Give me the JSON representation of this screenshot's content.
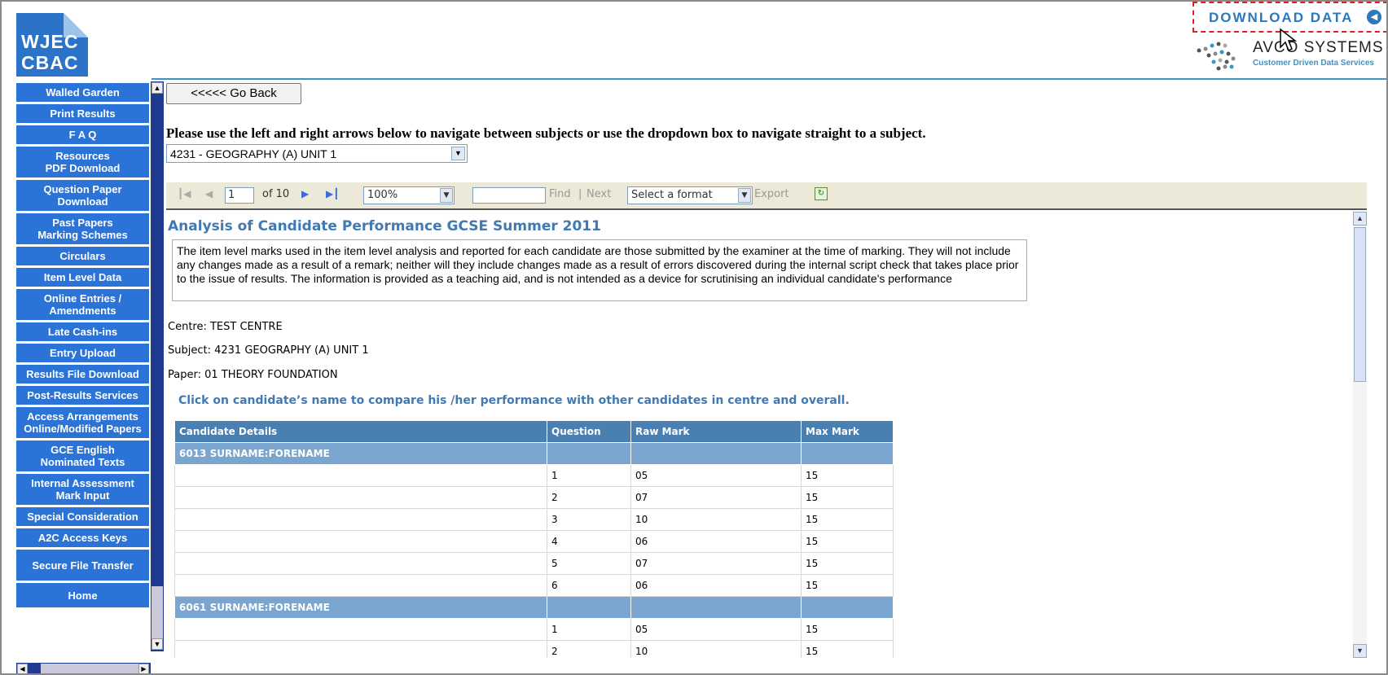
{
  "logo": {
    "line1": "WJEC",
    "line2": "CBAC"
  },
  "download": {
    "label": "DOWNLOAD DATA"
  },
  "avco": {
    "name": "AVCO SYSTEMS",
    "tagline": "Customer Driven Data Services"
  },
  "sidebar": {
    "items": [
      {
        "label": "Walled Garden"
      },
      {
        "label": "Print Results"
      },
      {
        "label": "F A Q"
      },
      {
        "label": "Resources\nPDF Download"
      },
      {
        "label": "Question Paper\nDownload"
      },
      {
        "label": "Past Papers\nMarking Schemes"
      },
      {
        "label": "Circulars"
      },
      {
        "label": "Item Level Data"
      },
      {
        "label": "Online Entries /\nAmendments"
      },
      {
        "label": "Late Cash-ins"
      },
      {
        "label": "Entry Upload"
      },
      {
        "label": "Results File Download"
      },
      {
        "label": "Post-Results Services"
      },
      {
        "label": "Access Arrangements\nOnline/Modified Papers"
      },
      {
        "label": "GCE English\nNominated Texts"
      },
      {
        "label": "Internal Assessment\nMark Input"
      },
      {
        "label": "Special Consideration"
      },
      {
        "label": "A2C Access Keys"
      },
      {
        "label": "Secure File Transfer"
      },
      {
        "label": "Home"
      }
    ]
  },
  "main": {
    "go_back": "<<<<< Go Back",
    "instructions": "Please use the left and right arrows below to navigate between subjects or use the dropdown box to navigate straight to a subject.",
    "subject_selected": "4231 - GEOGRAPHY (A) UNIT 1"
  },
  "toolbar": {
    "page": "1",
    "of_pages": "of 10",
    "zoom": "100%",
    "find_value": "",
    "find_label": "Find",
    "separator": "|",
    "next_label": "Next",
    "format_placeholder": "Select a format",
    "export_label": "Export"
  },
  "report": {
    "title": "Analysis of Candidate Performance GCSE Summer 2011",
    "disclaimer": "The item level marks used in the item level analysis and reported for each candidate are those submitted by the examiner at the time of marking. They will not include any changes made as a result of a remark; neither will they include changes made as a result of errors discovered during the internal script check that takes place prior to the issue of results. The information is provided as a teaching aid, and is not intended as a device for scrutinising an individual candidate's performance",
    "centre": "Centre: TEST CENTRE",
    "subject": "Subject: 4231 GEOGRAPHY (A) UNIT 1",
    "paper": "Paper: 01 THEORY FOUNDATION",
    "compare_hint": "Click on candidate’s name to compare his /her performance with other candidates in centre and overall.",
    "table": {
      "headers": [
        "Candidate Details",
        "Question",
        "Raw Mark",
        "Max Mark"
      ],
      "candidates": [
        {
          "name": "6013 SURNAME:FORENAME",
          "rows": [
            {
              "q": "1",
              "raw": "05",
              "max": "15"
            },
            {
              "q": "2",
              "raw": "07",
              "max": "15"
            },
            {
              "q": "3",
              "raw": "10",
              "max": "15"
            },
            {
              "q": "4",
              "raw": "06",
              "max": "15"
            },
            {
              "q": "5",
              "raw": "07",
              "max": "15"
            },
            {
              "q": "6",
              "raw": "06",
              "max": "15"
            }
          ]
        },
        {
          "name": "6061 SURNAME:FORENAME",
          "rows": [
            {
              "q": "1",
              "raw": "05",
              "max": "15"
            },
            {
              "q": "2",
              "raw": "10",
              "max": "15"
            }
          ]
        }
      ]
    }
  },
  "colors": {
    "nav_blue": "#2b73d6",
    "heading_blue": "#4179b3",
    "table_header": "#4a7fb2",
    "group_row": "#79a5cf",
    "download_border": "#e0201b"
  }
}
